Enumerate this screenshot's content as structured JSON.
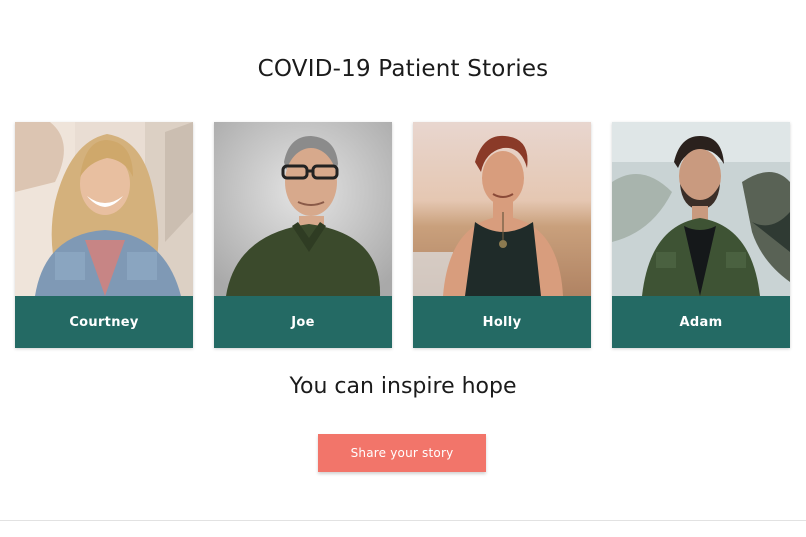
{
  "header": {
    "title": "COVID-19 Patient Stories"
  },
  "stories": [
    {
      "name": "Courtney"
    },
    {
      "name": "Joe"
    },
    {
      "name": "Holly"
    },
    {
      "name": "Adam"
    }
  ],
  "cta": {
    "heading": "You can inspire hope",
    "button_label": "Share your story"
  },
  "colors": {
    "card_label_bg": "#246a64",
    "button_bg": "#f2756a"
  }
}
